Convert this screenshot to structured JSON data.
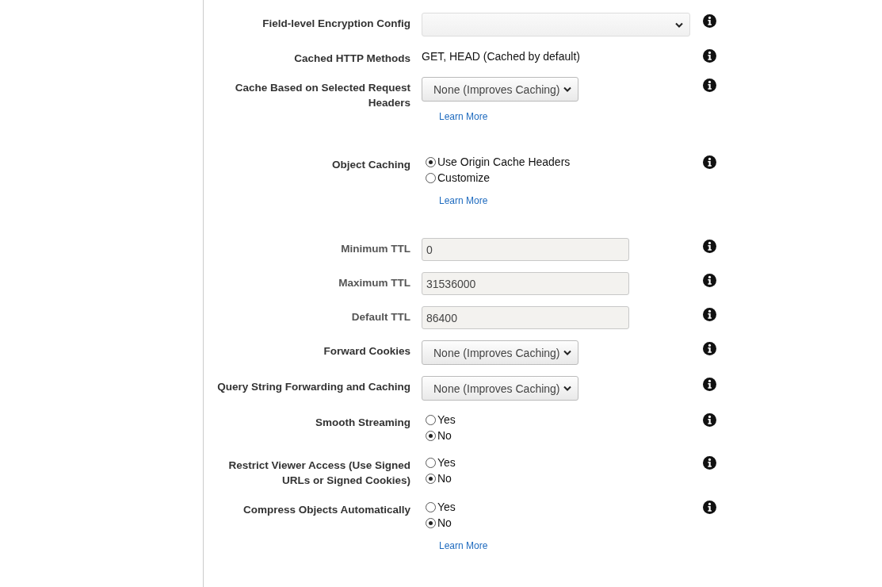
{
  "rows": [
    {
      "kind": "field-select",
      "label": "Field-level Encryption Config",
      "disabled": false
    },
    {
      "kind": "text",
      "label": "Cached HTTP Methods",
      "value": "GET, HEAD (Cached by default)",
      "disabled": false
    },
    {
      "kind": "dropdown",
      "label": "Cache Based on Selected Request Headers",
      "value": "None (Improves Caching)",
      "learn_more": "Learn More",
      "disabled": false
    },
    {
      "kind": "radio",
      "label": "Object Caching",
      "options": [
        {
          "label": "Use Origin Cache Headers",
          "selected": true
        },
        {
          "label": "Customize",
          "selected": false
        }
      ],
      "learn_more": "Learn More",
      "disabled": false
    },
    {
      "kind": "input",
      "label": "Minimum TTL",
      "value": "0",
      "disabled": true
    },
    {
      "kind": "input",
      "label": "Maximum TTL",
      "value": "31536000",
      "disabled": true
    },
    {
      "kind": "input",
      "label": "Default TTL",
      "value": "86400",
      "disabled": true
    },
    {
      "kind": "dropdown",
      "label": "Forward Cookies",
      "value": "None (Improves Caching)",
      "disabled": false
    },
    {
      "kind": "dropdown",
      "label": "Query String Forwarding and Caching",
      "value": "None (Improves Caching)",
      "disabled": false
    },
    {
      "kind": "radio",
      "label": "Smooth Streaming",
      "options": [
        {
          "label": "Yes",
          "selected": false
        },
        {
          "label": "No",
          "selected": true
        }
      ],
      "disabled": false
    },
    {
      "kind": "radio",
      "label": "Restrict Viewer Access (Use Signed URLs or Signed Cookies)",
      "options": [
        {
          "label": "Yes",
          "selected": false
        },
        {
          "label": "No",
          "selected": true
        }
      ],
      "disabled": false
    },
    {
      "kind": "radio",
      "label": "Compress Objects Automatically",
      "options": [
        {
          "label": "Yes",
          "selected": false
        },
        {
          "label": "No",
          "selected": true
        }
      ],
      "learn_more": "Learn More",
      "disabled": false
    }
  ]
}
